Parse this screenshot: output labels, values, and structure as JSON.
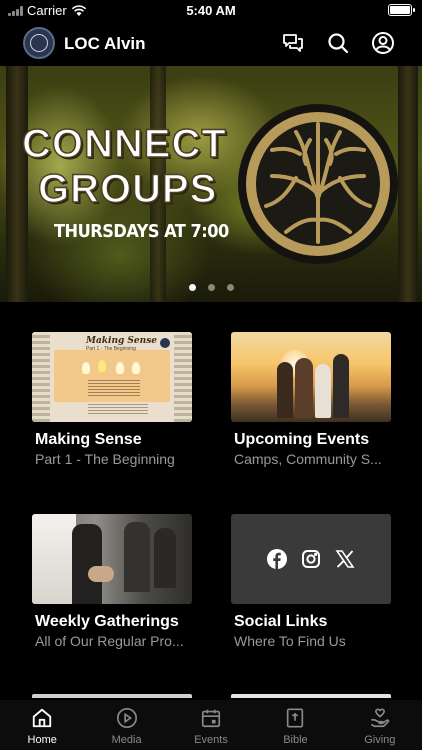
{
  "status": {
    "carrier": "Carrier",
    "time": "5:40 AM"
  },
  "header": {
    "app_title": "LOC Alvin",
    "icons": [
      "chat-icon",
      "search-icon",
      "account-icon"
    ]
  },
  "hero": {
    "title_line1": "CONNECT",
    "title_line2": "GROUPS",
    "subtitle": "THURSDAYS AT 7:00",
    "slide_count": 3,
    "active_slide": 1
  },
  "cards": [
    {
      "title": "Making Sense",
      "subtitle": "Part 1 - The Beginning",
      "thumb_text": "Making Sense",
      "thumb_sub": "Part 1 - The Beginning"
    },
    {
      "title": "Upcoming Events",
      "subtitle": "Camps, Community S..."
    },
    {
      "title": "Weekly Gatherings",
      "subtitle": "All of Our Regular Pro..."
    },
    {
      "title": "Social Links",
      "subtitle": "Where To Find Us",
      "icons": [
        "facebook-icon",
        "instagram-icon",
        "x-icon"
      ]
    }
  ],
  "tabs": [
    {
      "label": "Home",
      "icon": "home-icon",
      "active": true
    },
    {
      "label": "Media",
      "icon": "play-icon",
      "active": false
    },
    {
      "label": "Events",
      "icon": "calendar-icon",
      "active": false
    },
    {
      "label": "Bible",
      "icon": "bible-icon",
      "active": false
    },
    {
      "label": "Giving",
      "icon": "giving-icon",
      "active": false
    }
  ],
  "colors": {
    "background": "#000000",
    "tab_active": "#ffffff",
    "tab_inactive": "#8a8a8a",
    "tree_gold": "#b89a5a"
  }
}
